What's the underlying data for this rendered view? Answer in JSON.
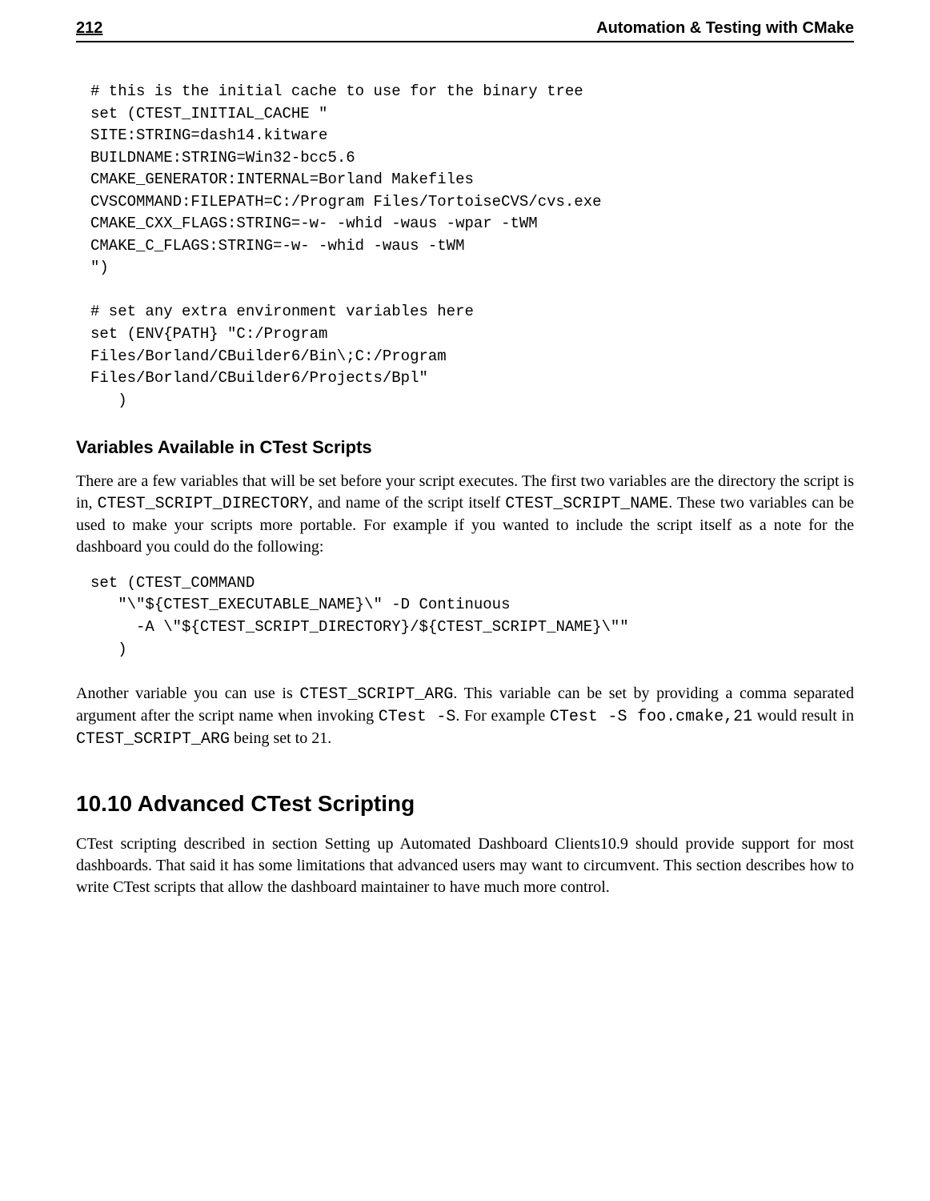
{
  "header": {
    "page_number": "212",
    "title": "Automation & Testing with CMake"
  },
  "code1": "# this is the initial cache to use for the binary tree\nset (CTEST_INITIAL_CACHE \"\nSITE:STRING=dash14.kitware\nBUILDNAME:STRING=Win32-bcc5.6\nCMAKE_GENERATOR:INTERNAL=Borland Makefiles\nCVSCOMMAND:FILEPATH=C:/Program Files/TortoiseCVS/cvs.exe\nCMAKE_CXX_FLAGS:STRING=-w- -whid -waus -wpar -tWM\nCMAKE_C_FLAGS:STRING=-w- -whid -waus -tWM\n\")\n\n# set any extra environment variables here\nset (ENV{PATH} \"C:/Program\nFiles/Borland/CBuilder6/Bin\\;C:/Program\nFiles/Borland/CBuilder6/Projects/Bpl\"\n   )",
  "subsection_title": "Variables Available in CTest Scripts",
  "para1": {
    "t1": "There are a few variables that will be set before your script executes. The first two variables are the directory the script is in, ",
    "c1": "CTEST_SCRIPT_DIRECTORY",
    "t2": ", and name of the script itself ",
    "c2": "CTEST_SCRIPT_NAME",
    "t3": ". These two variables can be used to make your scripts more portable. For example if you wanted to include the script itself as a note for the dashboard you could do the following:"
  },
  "code2": "set (CTEST_COMMAND\n   \"\\\"${CTEST_EXECUTABLE_NAME}\\\" -D Continuous\n     -A \\\"${CTEST_SCRIPT_DIRECTORY}/${CTEST_SCRIPT_NAME}\\\"\"\n   )",
  "para2": {
    "t1": "Another variable you can use is ",
    "c1": "CTEST_SCRIPT_ARG",
    "t2": ". This variable can be set by providing a comma separated argument after the script name when invoking ",
    "c2": "CTest -S",
    "t3": ". For example ",
    "c3": "CTest -S foo.cmake,21",
    "t4": " would result in ",
    "c4": "CTEST_SCRIPT_ARG",
    "t5": " being set to 21."
  },
  "section_title": "10.10 Advanced CTest Scripting",
  "para3": "CTest scripting described in section Setting up Automated Dashboard Clients10.9 should provide support for most dashboards. That said it has some limitations that advanced users may want to circumvent. This section describes how to write CTest scripts that allow the dashboard maintainer to have much more control."
}
